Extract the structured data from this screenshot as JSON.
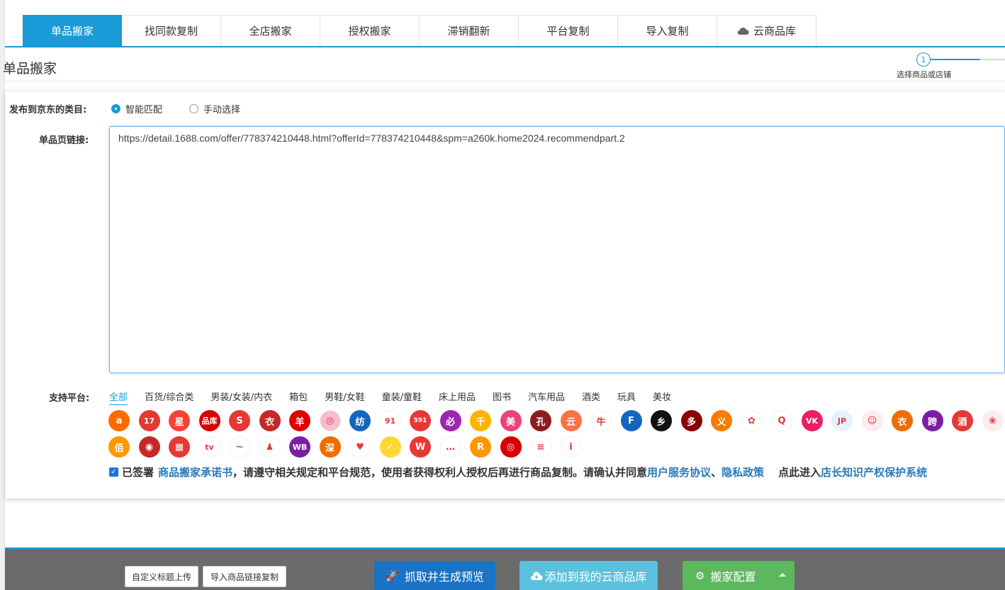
{
  "tabs": [
    "单品搬家",
    "找同款复制",
    "全店搬家",
    "授权搬家",
    "滞销翻新",
    "平台复制",
    "导入复制",
    "云商品库"
  ],
  "section_title": "单品搬家",
  "steps": {
    "number": "1",
    "label": "选择商品或店铺"
  },
  "category_row": {
    "label": "发布到京东的类目:",
    "options": [
      "智能匹配",
      "手动选择"
    ],
    "selected": "智能匹配"
  },
  "link_row": {
    "label": "单品页链接:",
    "value": "https://detail.1688.com/offer/778374210448.html?offerId=778374210448&spm=a260k.home2024.recommendpart.2"
  },
  "platform_row": {
    "label": "支持平台:",
    "categories": [
      "全部",
      "百货/综合类",
      "男装/女装/内衣",
      "箱包",
      "男鞋/女鞋",
      "童装/童鞋",
      "床上用品",
      "图书",
      "汽车用品",
      "酒类",
      "玩具",
      "美妆"
    ],
    "active_category": "全部",
    "icons_row1": [
      {
        "name": "alibaba-icon",
        "text": "a",
        "color": "#ff6a00"
      },
      {
        "name": "17zwd-icon",
        "text": "17",
        "color": "#e53935"
      },
      {
        "name": "star-icon",
        "text": "星",
        "color": "#f44336"
      },
      {
        "name": "pinku-icon",
        "text": "品库",
        "color": "#d50000"
      },
      {
        "name": "s-icon",
        "text": "S",
        "color": "#e53935"
      },
      {
        "name": "yi-icon",
        "text": "衣",
        "color": "#c62828"
      },
      {
        "name": "yang-icon",
        "text": "羊",
        "color": "#e00000"
      },
      {
        "name": "search-q-icon",
        "text": "◎",
        "color": "#f8bbd0"
      },
      {
        "name": "fang-icon",
        "text": "纺",
        "color": "#1565c0"
      },
      {
        "name": "91-icon",
        "text": "91",
        "color": "#ffffff"
      },
      {
        "name": "591-icon",
        "text": "591",
        "color": "#e53935"
      },
      {
        "name": "bi-icon",
        "text": "必",
        "color": "#9c27b0"
      },
      {
        "name": "qian-icon",
        "text": "千",
        "color": "#ffb300"
      },
      {
        "name": "mei-icon",
        "text": "美",
        "color": "#ec407a"
      },
      {
        "name": "kong-icon",
        "text": "孔",
        "color": "#8d1c1c"
      },
      {
        "name": "yun-icon",
        "text": "云",
        "color": "#ff7043"
      },
      {
        "name": "niu-icon",
        "text": "牛",
        "color": "#ffffff"
      },
      {
        "name": "f-icon",
        "text": "F",
        "color": "#1565c0"
      },
      {
        "name": "xiang-icon",
        "text": "乡",
        "color": "#111111"
      },
      {
        "name": "duo-icon",
        "text": "多",
        "color": "#8b0000"
      },
      {
        "name": "yiwu-icon",
        "text": "义",
        "color": "#f57c00"
      },
      {
        "name": "fire-icon",
        "text": "✿",
        "color": "#ffffff"
      },
      {
        "name": "q-icon",
        "text": "Q",
        "color": "#ffffff"
      },
      {
        "name": "vk-icon",
        "text": "VK",
        "color": "#e91e63"
      },
      {
        "name": "jp-icon",
        "text": "JP",
        "color": "#e3f2fd"
      },
      {
        "name": "bear-red-icon",
        "text": "☺",
        "color": "#ffebee"
      },
      {
        "name": "yi2-icon",
        "text": "衣",
        "color": "#ef6c00"
      },
      {
        "name": "kua-icon",
        "text": "跨",
        "color": "#7b1fa2"
      },
      {
        "name": "jiu-icon",
        "text": "酒",
        "color": "#e53935"
      },
      {
        "name": "pig-icon",
        "text": "❀",
        "color": "#ffebee"
      }
    ],
    "icons_row2": [
      {
        "name": "baihuo-icon",
        "text": "佰",
        "color": "#ff9800"
      },
      {
        "name": "emblem-icon",
        "text": "◉",
        "color": "#c62828"
      },
      {
        "name": "grid-icon",
        "text": "▦",
        "color": "#e53935"
      },
      {
        "name": "tv-icon",
        "text": "tv",
        "color": "#ffffff"
      },
      {
        "name": "pink-icon",
        "text": "~",
        "color": "#ffffff"
      },
      {
        "name": "figure-icon",
        "text": "♟",
        "color": "#ffffff"
      },
      {
        "name": "wb-icon",
        "text": "WB",
        "color": "#7b1fa2"
      },
      {
        "name": "shen-icon",
        "text": "深",
        "color": "#ef6c00"
      },
      {
        "name": "heart-icon",
        "text": "♥",
        "color": "#ffffff"
      },
      {
        "name": "check-icon",
        "text": "✓",
        "color": "#fdd835"
      },
      {
        "name": "w-icon",
        "text": "W",
        "color": "#e53935"
      },
      {
        "name": "text-logo-icon",
        "text": "…",
        "color": "#ffffff"
      },
      {
        "name": "r-icon",
        "text": "R",
        "color": "#ff9800"
      },
      {
        "name": "target-icon",
        "text": "◎",
        "color": "#d50000"
      },
      {
        "name": "doc-icon",
        "text": "≡",
        "color": "#ffffff"
      },
      {
        "name": "imbk-icon",
        "text": "i",
        "color": "#ffffff"
      }
    ]
  },
  "agreement": {
    "prefix": "已签署",
    "link1": "商品搬家承诺书",
    "middle": "，请遵守相关规定和平台规范，使用者获得权利人授权后再进行商品复制。请确认并同意",
    "link2": "用户服务协议",
    "sep": "、",
    "link3": "隐私政策",
    "enter": "点此进入",
    "link4": "店长知识产权保护系统"
  },
  "footer": {
    "btn_custom": "自定义标题上传",
    "btn_import": "导入商品链接复制",
    "btn_grab": "抓取并生成预览",
    "btn_add": "添加到我的云商品库",
    "btn_config": "搬家配置"
  },
  "colors": {
    "primary": "#1a9ad6",
    "grab": "#1a73c4",
    "add": "#5bc0de",
    "config": "#5cb85c"
  }
}
